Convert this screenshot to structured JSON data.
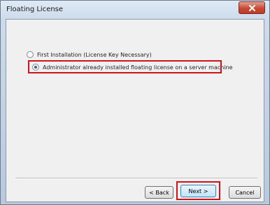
{
  "window": {
    "title": "Floating License",
    "close_symbol": "x"
  },
  "options": [
    {
      "label": "First Installation (License Key Necessary)",
      "selected": false
    },
    {
      "label": "Administrator already installed floating license on a server machine",
      "selected": true
    }
  ],
  "buttons": {
    "back": "< Back",
    "next": "Next >",
    "cancel": "Cancel"
  },
  "colors": {
    "highlight": "#d0121b",
    "close_button": "#c74a35"
  }
}
